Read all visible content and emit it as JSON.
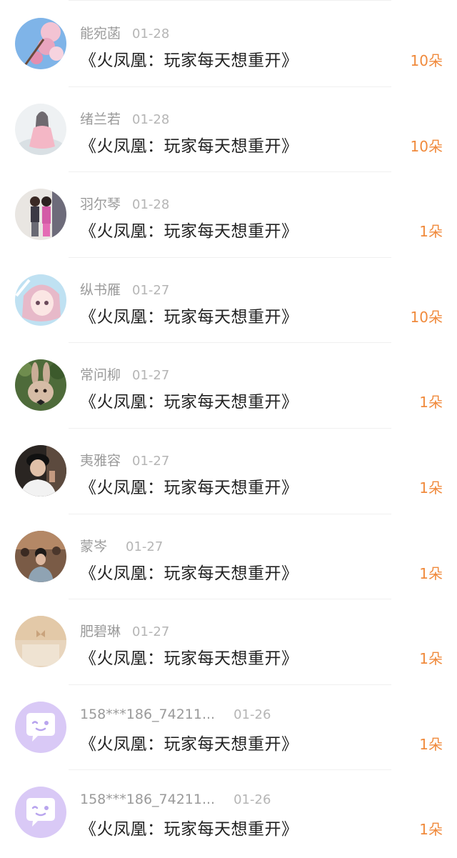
{
  "rows": [
    {
      "name": "能宛菡",
      "date": "01-28",
      "title": "《火凤凰：玩家每天想重开》",
      "amount": "10朵",
      "avatar": "magnolia-photo-avatar"
    },
    {
      "name": "绪兰若",
      "date": "01-28",
      "title": "《火凤凰：玩家每天想重开》",
      "amount": "10朵",
      "avatar": "anime-girl-avatar"
    },
    {
      "name": "羽尔琴",
      "date": "01-28",
      "title": "《火凤凰：玩家每天想重开》",
      "amount": "1朵",
      "avatar": "kids-photo-avatar"
    },
    {
      "name": "纵书雁",
      "date": "01-27",
      "title": "《火凤凰：玩家每天想重开》",
      "amount": "10朵",
      "avatar": "anime-pink-hair-avatar"
    },
    {
      "name": "常问柳",
      "date": "01-27",
      "title": "《火凤凰：玩家每天想重开》",
      "amount": "1朵",
      "avatar": "rabbit-photo-avatar"
    },
    {
      "name": "夷雅容",
      "date": "01-27",
      "title": "《火凤凰：玩家每天想重开》",
      "amount": "1朵",
      "avatar": "man-cap-photo-avatar"
    },
    {
      "name": "蒙岑",
      "date": "01-27",
      "title": "《火凤凰：玩家每天想重开》",
      "amount": "1朵",
      "avatar": "street-photo-avatar"
    },
    {
      "name": "肥碧琳",
      "date": "01-27",
      "title": "《火凤凰：玩家每天想重开》",
      "amount": "1朵",
      "avatar": "beige-texture-avatar"
    },
    {
      "name": "158***186_74211...",
      "date": "01-26",
      "title": "《火凤凰：玩家每天想重开》",
      "amount": "1朵",
      "avatar": "default-chat-bubble-avatar"
    },
    {
      "name": "158***186_74211...",
      "date": "01-26",
      "title": "《火凤凰：玩家每天想重开》",
      "amount": "1朵",
      "avatar": "default-chat-bubble-avatar"
    }
  ],
  "colors": {
    "amount": "#f08a3c",
    "name": "#9a9a9a",
    "title": "#222222",
    "default_avatar": "#d9c9f6"
  }
}
